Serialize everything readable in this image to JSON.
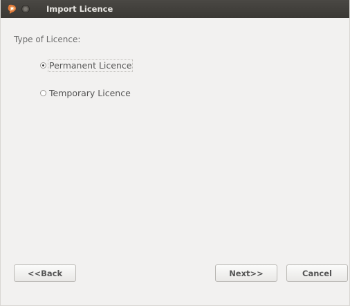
{
  "window": {
    "title": "Import Licence"
  },
  "form": {
    "section_label": "Type of Licence:",
    "options": [
      {
        "label": "Permanent Licence",
        "selected": true
      },
      {
        "label": "Temporary Licence",
        "selected": false
      }
    ]
  },
  "buttons": {
    "back": "<<Back",
    "next": "Next>>",
    "cancel": "Cancel"
  },
  "colors": {
    "titlebar": "#3f3d39",
    "window_bg": "#f2f1f0",
    "text_muted": "#6a6a6a"
  },
  "icons": {
    "app": "app-logo-icon",
    "close": "close-icon"
  }
}
